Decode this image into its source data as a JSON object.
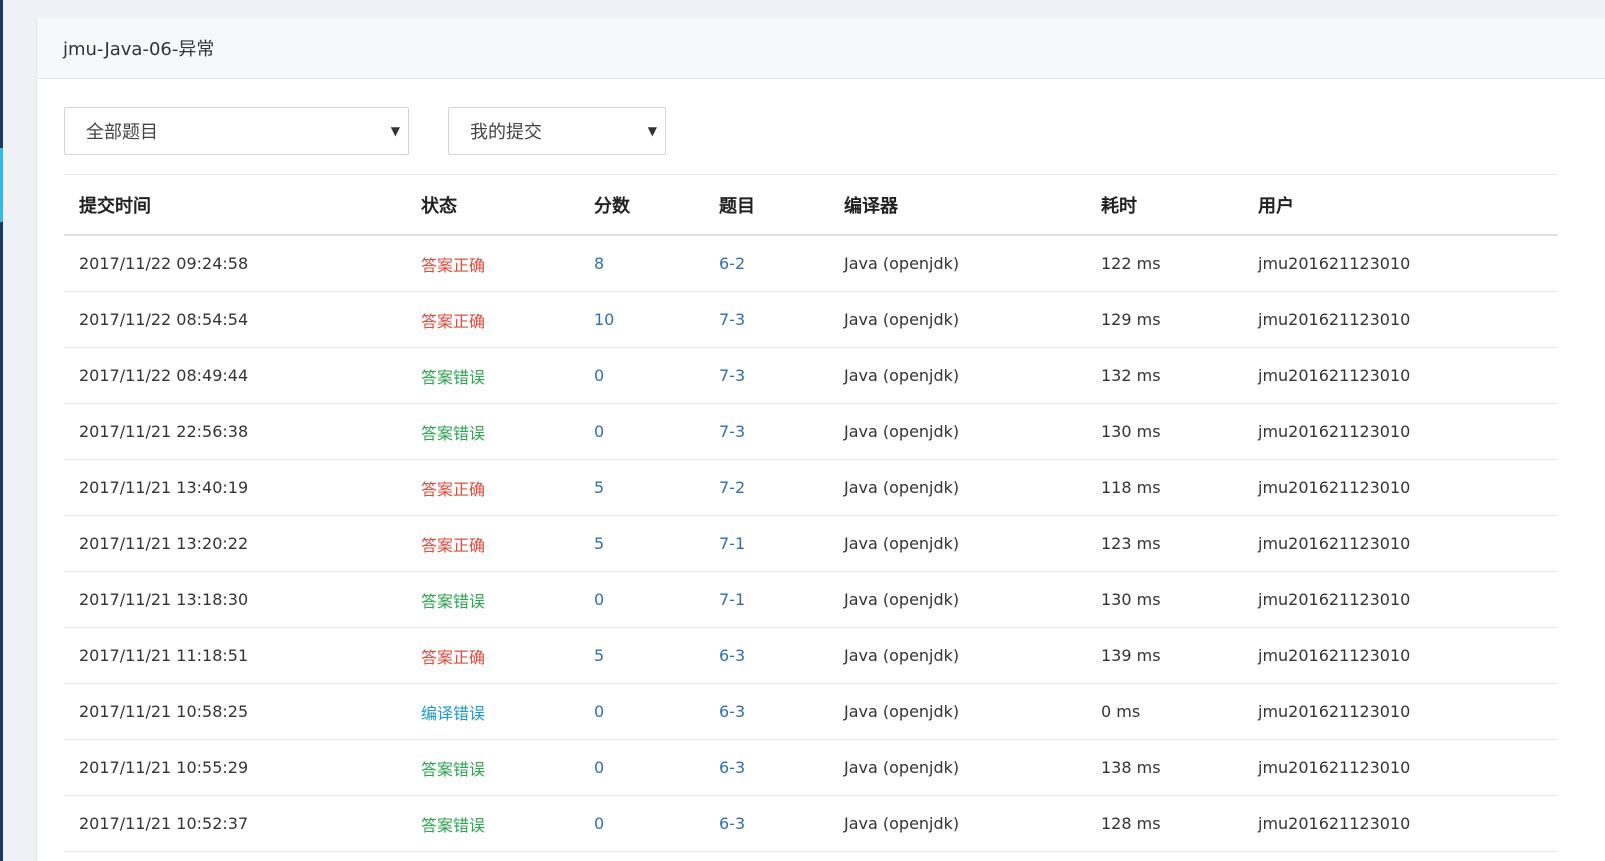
{
  "page": {
    "title": "jmu-Java-06-异常"
  },
  "filters": {
    "problem_select": "全部题目",
    "submitter_select": "我的提交"
  },
  "table": {
    "headers": [
      "提交时间",
      "状态",
      "分数",
      "题目",
      "编译器",
      "耗时",
      "用户"
    ],
    "rows": [
      {
        "time": "2017/11/22 09:24:58",
        "status": "答案正确",
        "status_type": "ok",
        "score": "8",
        "problem": "6-2",
        "compiler": "Java (openjdk)",
        "duration": "122 ms",
        "user": "jmu201621123010"
      },
      {
        "time": "2017/11/22 08:54:54",
        "status": "答案正确",
        "status_type": "ok",
        "score": "10",
        "problem": "7-3",
        "compiler": "Java (openjdk)",
        "duration": "129 ms",
        "user": "jmu201621123010"
      },
      {
        "time": "2017/11/22 08:49:44",
        "status": "答案错误",
        "status_type": "wrong",
        "score": "0",
        "problem": "7-3",
        "compiler": "Java (openjdk)",
        "duration": "132 ms",
        "user": "jmu201621123010"
      },
      {
        "time": "2017/11/21 22:56:38",
        "status": "答案错误",
        "status_type": "wrong",
        "score": "0",
        "problem": "7-3",
        "compiler": "Java (openjdk)",
        "duration": "130 ms",
        "user": "jmu201621123010"
      },
      {
        "time": "2017/11/21 13:40:19",
        "status": "答案正确",
        "status_type": "ok",
        "score": "5",
        "problem": "7-2",
        "compiler": "Java (openjdk)",
        "duration": "118 ms",
        "user": "jmu201621123010"
      },
      {
        "time": "2017/11/21 13:20:22",
        "status": "答案正确",
        "status_type": "ok",
        "score": "5",
        "problem": "7-1",
        "compiler": "Java (openjdk)",
        "duration": "123 ms",
        "user": "jmu201621123010"
      },
      {
        "time": "2017/11/21 13:18:30",
        "status": "答案错误",
        "status_type": "wrong",
        "score": "0",
        "problem": "7-1",
        "compiler": "Java (openjdk)",
        "duration": "130 ms",
        "user": "jmu201621123010"
      },
      {
        "time": "2017/11/21 11:18:51",
        "status": "答案正确",
        "status_type": "ok",
        "score": "5",
        "problem": "6-3",
        "compiler": "Java (openjdk)",
        "duration": "139 ms",
        "user": "jmu201621123010"
      },
      {
        "time": "2017/11/21 10:58:25",
        "status": "编译错误",
        "status_type": "compile",
        "score": "0",
        "problem": "6-3",
        "compiler": "Java (openjdk)",
        "duration": "0 ms",
        "user": "jmu201621123010"
      },
      {
        "time": "2017/11/21 10:55:29",
        "status": "答案错误",
        "status_type": "wrong",
        "score": "0",
        "problem": "6-3",
        "compiler": "Java (openjdk)",
        "duration": "138 ms",
        "user": "jmu201621123010"
      },
      {
        "time": "2017/11/21 10:52:37",
        "status": "答案错误",
        "status_type": "wrong",
        "score": "0",
        "problem": "6-3",
        "compiler": "Java (openjdk)",
        "duration": "128 ms",
        "user": "jmu201621123010"
      }
    ]
  },
  "colors": {
    "status_ok": "#e24b3b",
    "status_wrong": "#2ea44f",
    "status_compile": "#1b9ad6",
    "link": "#2f6eb5"
  },
  "icons": {
    "select_caret": "caret-down-icon"
  }
}
